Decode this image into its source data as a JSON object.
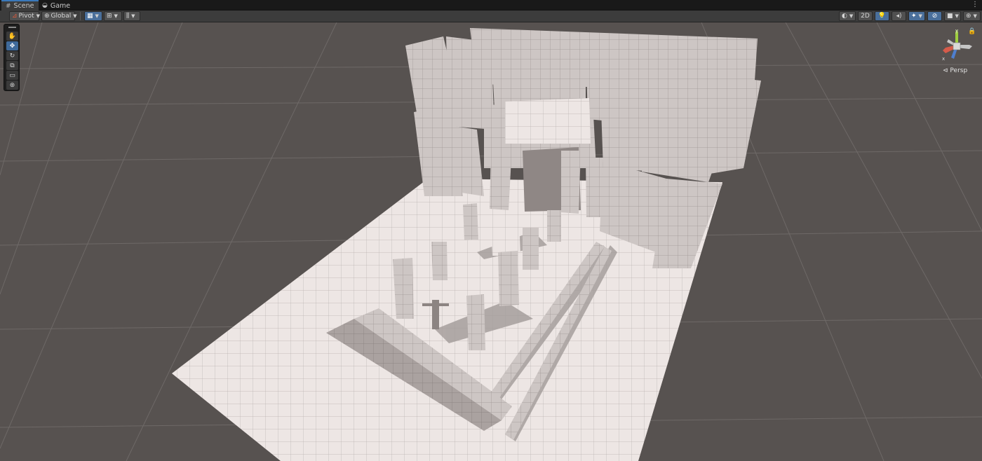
{
  "tabs": [
    {
      "label": "Scene",
      "icon": "grid-icon",
      "active": true
    },
    {
      "label": "Game",
      "icon": "gamepad-icon",
      "active": false
    }
  ],
  "toolbar": {
    "pivot_label": "Pivot",
    "global_label": "Global",
    "twod_label": "2D"
  },
  "viewport": {
    "camera_mode": "Persp",
    "gizmo_y": "y",
    "gizmo_x": "x",
    "background_color": "#575250",
    "grid_color": "#6e6967",
    "floor_color": "#ede6e4"
  },
  "tools": [
    {
      "name": "view-tool",
      "icon": "hand-icon"
    },
    {
      "name": "move-tool",
      "icon": "move-icon",
      "active": true
    },
    {
      "name": "rotate-tool",
      "icon": "rotate-icon"
    },
    {
      "name": "scale-tool",
      "icon": "scale-icon"
    },
    {
      "name": "rect-tool",
      "icon": "rect-icon"
    },
    {
      "name": "transform-tool",
      "icon": "transform-icon"
    }
  ]
}
